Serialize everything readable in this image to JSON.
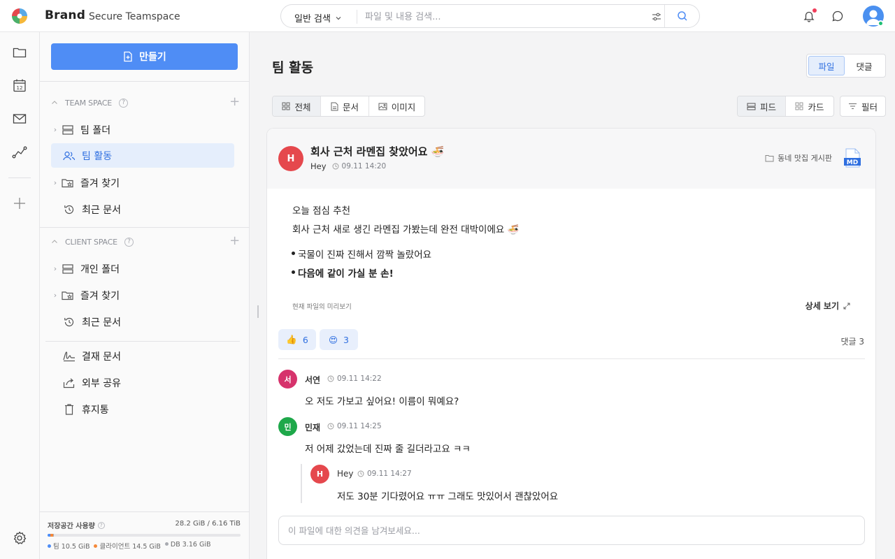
{
  "header": {
    "brand": "Brand",
    "subtitle": "Secure Teamspace",
    "search_scope": "일반 검색",
    "search_placeholder": "파일 및 내용 검색...",
    "icons": [
      "logo-icon",
      "chevron-down-icon",
      "filter-sliders-icon",
      "search-icon",
      "bell-icon",
      "chat-icon",
      "user-avatar"
    ]
  },
  "rail": {
    "icons": [
      "folder-icon",
      "calendar-icon",
      "mail-icon",
      "route-icon",
      "plus-icon",
      "settings-icon"
    ],
    "calendar_day": "12"
  },
  "sidebar": {
    "create_label": "만들기",
    "team_space": {
      "title": "TEAM SPACE",
      "items": [
        {
          "label": "팀 폴더",
          "icon": "server-icon",
          "expandable": true
        },
        {
          "label": "팀 활동",
          "icon": "users-icon",
          "active": true
        },
        {
          "label": "즐겨 찾기",
          "icon": "star-folder-icon",
          "expandable": true
        },
        {
          "label": "최근 문서",
          "icon": "history-icon"
        }
      ]
    },
    "client_space": {
      "title": "CLIENT SPACE",
      "items": [
        {
          "label": "개인 폴더",
          "icon": "server-icon",
          "expandable": true
        },
        {
          "label": "즐겨 찾기",
          "icon": "star-folder-icon",
          "expandable": true
        },
        {
          "label": "최근 문서",
          "icon": "history-icon"
        }
      ]
    },
    "extra_items": [
      {
        "label": "결재 문서",
        "icon": "signature-icon"
      },
      {
        "label": "외부 공유",
        "icon": "share-icon"
      },
      {
        "label": "휴지통",
        "icon": "trash-icon"
      }
    ],
    "storage": {
      "label": "저장공간 사용량",
      "total": "28.2 GiB / 6.16 TiB",
      "segments": [
        {
          "label": "팀",
          "value": "10.5 GiB",
          "color": "#4f8df5",
          "fraction": 0.0017
        },
        {
          "label": "클라이언트",
          "value": "14.5 GiB",
          "color": "#f5893a",
          "fraction": 0.0023
        },
        {
          "label": "DB",
          "value": "3.16 GiB",
          "color": "#a9abb1",
          "fraction": 0.0005
        }
      ]
    }
  },
  "main": {
    "title": "팀 활동",
    "view_toggle": [
      "파일",
      "댓글"
    ],
    "view_toggle_active": "파일",
    "type_tabs": [
      "전체",
      "문서",
      "이미지"
    ],
    "type_tabs_active": "전체",
    "layout_toggle": [
      "피드",
      "카드"
    ],
    "layout_toggle_active": "피드",
    "filter_label": "필터"
  },
  "post": {
    "avatar_initial": "H",
    "title": "회사 근처 라멘집 찾았어요 🍜",
    "author": "Hey",
    "time": "09.11 14:20",
    "folder": "동네 맛집 게시판",
    "file_type": "MD",
    "body_lines": [
      "오늘 점심 추천",
      "회사 근처 새로 생긴 라멘집 가봤는데 완전 대박이에요 🍜"
    ],
    "bullets": [
      "국물이 진짜 진해서 깜짝 놀랐어요",
      "다음에 같이 가실 분 손!"
    ],
    "preview_label": "현재 파일의 미리보기",
    "detail_label": "상세 보기",
    "reactions": [
      {
        "emoji": "👍",
        "count": "6"
      },
      {
        "emoji": "😍",
        "count": "3"
      }
    ],
    "comment_count": "댓글 3",
    "comments": [
      {
        "initial": "서",
        "name": "서연",
        "time": "09.11 14:22",
        "text": "오 저도 가보고 싶어요! 이름이 뭐예요?",
        "color": "#d6336c"
      },
      {
        "initial": "민",
        "name": "민재",
        "time": "09.11 14:25",
        "text": "저 어제 갔었는데 진짜 줄 길더라고요 ㅋㅋ",
        "color": "#1ea84a"
      }
    ],
    "reply": {
      "initial": "H",
      "name": "Hey",
      "time": "09.11 14:27",
      "text": "저도 30분 기다렸어요 ㅠㅠ 그래도 맛있어서 괜찮았어요",
      "color": "#e5484d"
    },
    "comment_placeholder": "이 파일에 대한 의견을 남겨보세요..."
  }
}
